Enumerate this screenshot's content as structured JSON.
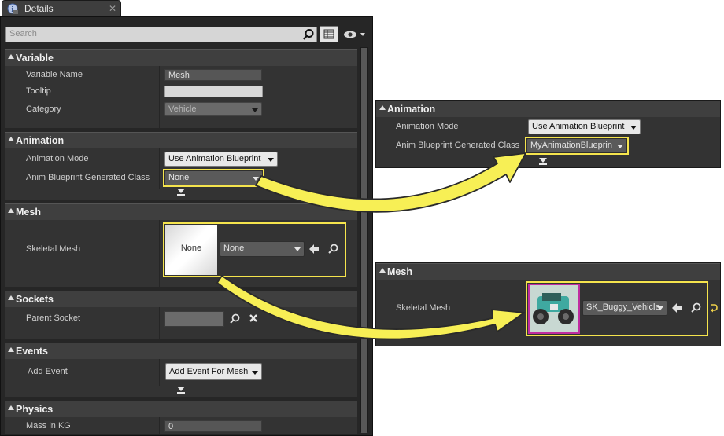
{
  "tab": {
    "title": "Details",
    "close": "✕"
  },
  "search": {
    "placeholder": "Search"
  },
  "sections": {
    "variable": {
      "header": "Variable",
      "variable_name_label": "Variable Name",
      "variable_name_value": "Mesh",
      "tooltip_label": "Tooltip",
      "tooltip_value": "",
      "category_label": "Category",
      "category_value": "Vehicle"
    },
    "animation": {
      "header": "Animation",
      "mode_label": "Animation Mode",
      "mode_value": "Use Animation Blueprint",
      "class_label": "Anim Blueprint Generated Class",
      "class_value": "None"
    },
    "mesh": {
      "header": "Mesh",
      "skeletal_label": "Skeletal Mesh",
      "thumb_text": "None",
      "combo_value": "None"
    },
    "sockets": {
      "header": "Sockets",
      "parent_label": "Parent Socket",
      "parent_value": ""
    },
    "events": {
      "header": "Events",
      "add_label": "Add Event",
      "add_button": "Add Event For Mesh"
    },
    "physics": {
      "header": "Physics",
      "mass_label": "Mass in KG",
      "mass_value": "0"
    }
  },
  "callout_animation": {
    "header": "Animation",
    "mode_label": "Animation Mode",
    "mode_value": "Use Animation Blueprint",
    "class_label": "Anim Blueprint Generated Class",
    "class_value": "MyAnimationBlueprin"
  },
  "callout_mesh": {
    "header": "Mesh",
    "skeletal_label": "Skeletal Mesh",
    "combo_value": "SK_Buggy_Vehicle"
  },
  "colors": {
    "highlight": "#f5e44d",
    "arrow_fill": "#f7ef55",
    "panel_bg": "#333333",
    "category_bg": "#3f3f3f",
    "thumb_border": "#c02ca0"
  },
  "icons": {
    "details": "details-tab-icon",
    "search": "magnifier-icon",
    "grid": "property-matrix-icon",
    "eye": "eye-visibility-icon",
    "use_selected": "arrow-left-icon",
    "browse": "magnifier-icon",
    "clear": "clear-x-icon",
    "reset": "reset-to-default-icon"
  }
}
